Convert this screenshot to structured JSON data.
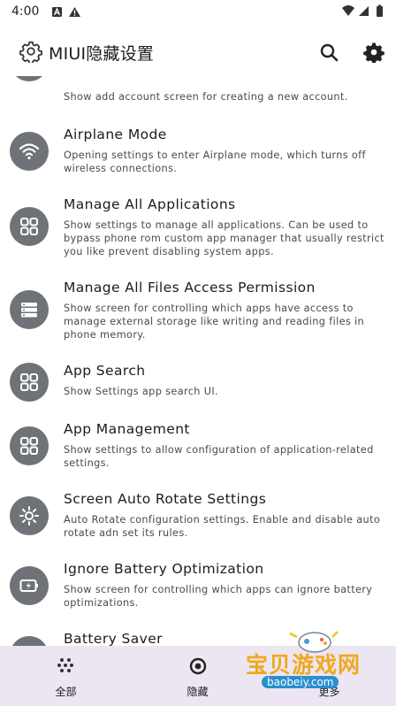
{
  "status_bar": {
    "time": "4:00"
  },
  "app_bar": {
    "title": "MIUI隐藏设置"
  },
  "items": [
    {
      "icon": "account-icon",
      "title": "",
      "desc": "Show add account screen for creating a new account."
    },
    {
      "icon": "wifi-icon",
      "title": "Airplane Mode",
      "desc": "Opening settings to enter Airplane mode, which turns off wireless connections."
    },
    {
      "icon": "apps-grid-icon",
      "title": "Manage All Applications",
      "desc": "Show settings to manage all applications. Can be used to bypass phone rom custom app manager that usually restrict you like prevent disabling system apps."
    },
    {
      "icon": "storage-icon",
      "title": "Manage All Files Access Permission",
      "desc": "Show screen for controlling which apps have access to manage external storage like writing and reading files in phone memory."
    },
    {
      "icon": "apps-grid-icon",
      "title": "App Search",
      "desc": "Show Settings app search UI."
    },
    {
      "icon": "apps-grid-icon",
      "title": "App Management",
      "desc": "Show settings to allow configuration of application-related settings."
    },
    {
      "icon": "brightness-icon",
      "title": "Screen Auto Rotate Settings",
      "desc": "Auto Rotate configuration settings. Enable and disable auto rotate adn set its rules."
    },
    {
      "icon": "battery-charging-icon",
      "title": "Ignore Battery Optimization",
      "desc": "Show screen for controlling which apps can ignore battery optimizations."
    },
    {
      "icon": "battery-icon",
      "title": "Battery Saver",
      "desc": ""
    }
  ],
  "bottom_nav": [
    {
      "label": "全部",
      "icon": "dots-grid-icon"
    },
    {
      "label": "隐藏",
      "icon": "target-icon"
    },
    {
      "label": "更多",
      "icon": "more-icon"
    }
  ],
  "watermark": {
    "brand": "宝贝游戏网",
    "url": "baobeiy.com"
  }
}
